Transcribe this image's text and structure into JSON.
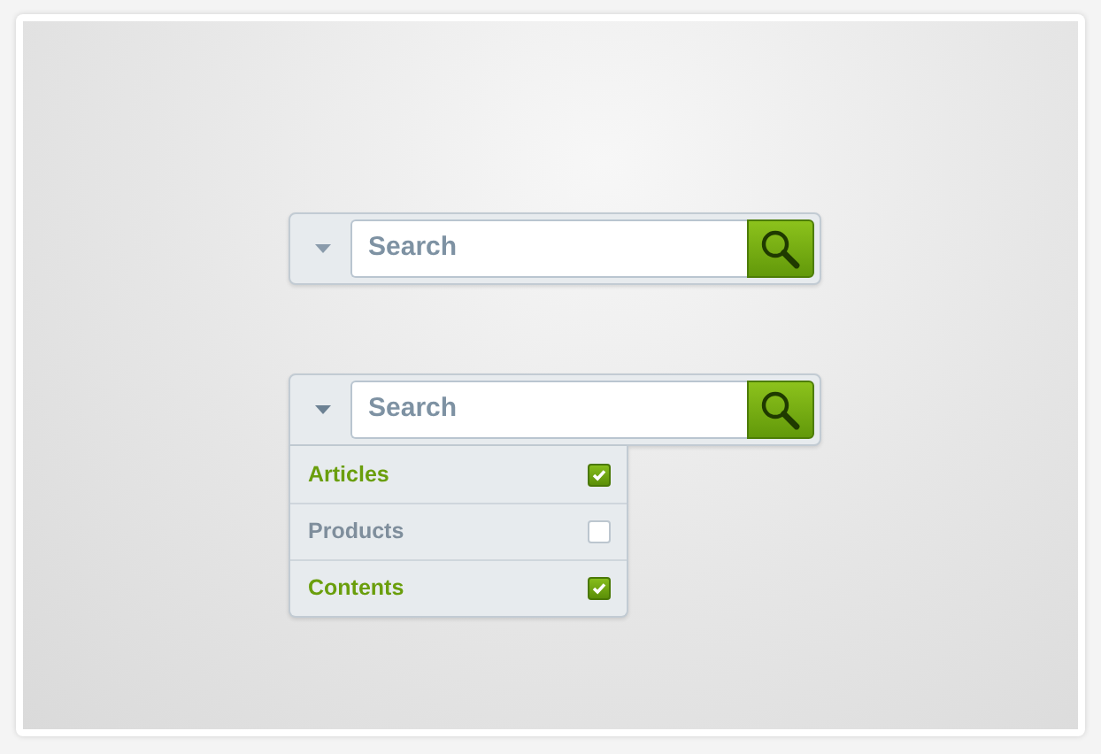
{
  "search_bars": [
    {
      "placeholder": "Search",
      "expanded": false
    },
    {
      "placeholder": "Search",
      "expanded": true,
      "options": [
        {
          "label": "Articles",
          "checked": true
        },
        {
          "label": "Products",
          "checked": false
        },
        {
          "label": "Contents",
          "checked": true
        }
      ]
    }
  ]
}
